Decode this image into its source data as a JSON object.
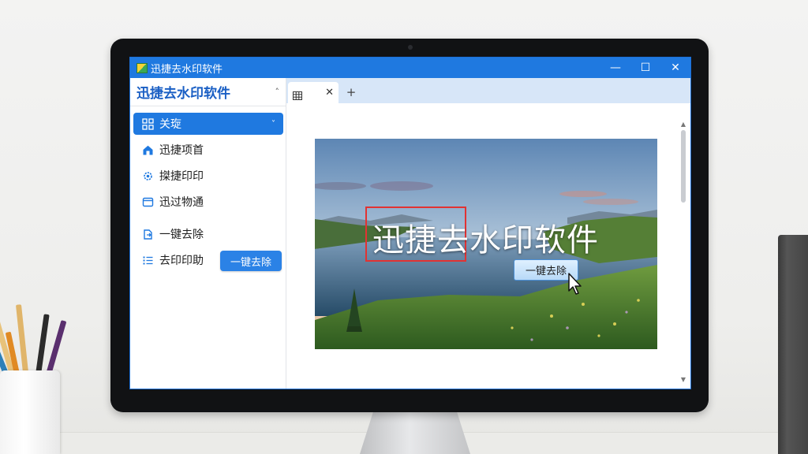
{
  "window": {
    "title": "迅捷去水印软件",
    "controls": {
      "minimize": "—",
      "maximize": "☐",
      "close": "✕"
    }
  },
  "sidebar": {
    "header_title": "迅捷去水印软件",
    "header_chevron": "˄",
    "items": [
      {
        "label": "关琁",
        "icon": "grid-icon",
        "active": true,
        "chevron": "˅"
      },
      {
        "label": "迅捷项首",
        "icon": "home-icon"
      },
      {
        "label": "搩捷印印",
        "icon": "gear-icon"
      },
      {
        "label": "迅过物通",
        "icon": "window-icon"
      },
      {
        "label": "一键去除",
        "icon": "export-icon"
      },
      {
        "label": "去印印助",
        "icon": "list-icon"
      }
    ],
    "action_button": "一键去除"
  },
  "tabs": {
    "items": [
      {
        "icon": "table-icon",
        "close": "✕"
      }
    ],
    "add": "+"
  },
  "preview": {
    "watermark_text": "迅捷去水印软件",
    "overlay_button": "一键去除"
  },
  "scrollbar": {
    "up": "▲",
    "down": "▼"
  },
  "colors": {
    "accent": "#1f79e0",
    "highlight_border": "#e23232",
    "tabbar": "#d7e6f8"
  }
}
